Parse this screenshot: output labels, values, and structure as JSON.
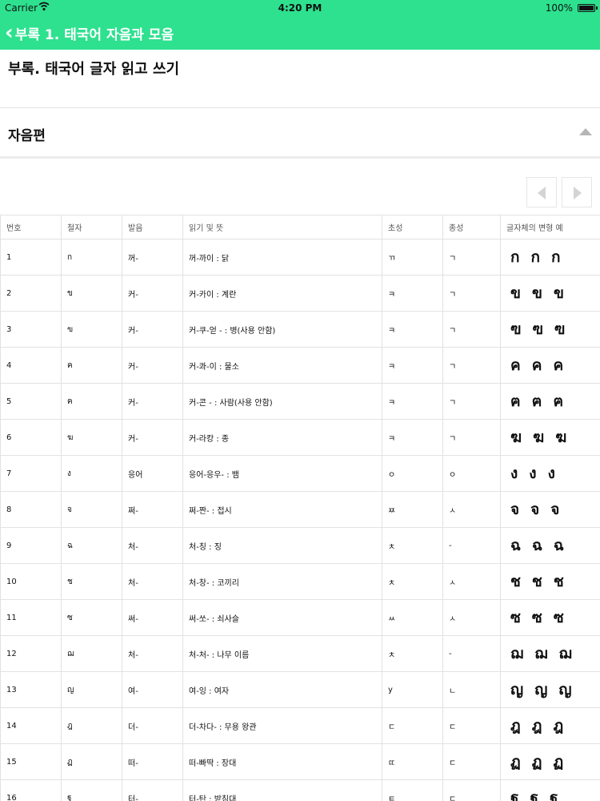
{
  "status_bar": {
    "carrier": "Carrier",
    "time": "4:20 PM",
    "battery": "100%"
  },
  "nav": {
    "back_label": "부록 1. 태국어 자음과 모음"
  },
  "document": {
    "title": "부록. 태국어 글자 읽고 쓰기"
  },
  "section": {
    "title": "자음편"
  },
  "table": {
    "headers": [
      "번호",
      "철자",
      "발음",
      "읽기 및 뜻",
      "초성",
      "종성",
      "글자체의 변형 예"
    ],
    "rows": [
      {
        "no": "1",
        "letter": "ก",
        "sound": "꺼-",
        "reading": "꺼-까이 : 닭",
        "initial": "ㄲ",
        "final": "ㄱ",
        "variants": [
          "ก",
          "ก",
          "ก"
        ]
      },
      {
        "no": "2",
        "letter": "ข",
        "sound": "커-",
        "reading": "커-카이 : 계란",
        "initial": "ㅋ",
        "final": "ㄱ",
        "variants": [
          "ข",
          "ข",
          "ข"
        ]
      },
      {
        "no": "3",
        "letter": "ฃ",
        "sound": "커-",
        "reading": "커-쿠-얻 - : 병(사용 안함)",
        "initial": "ㅋ",
        "final": "ㄱ",
        "variants": [
          "ฃ",
          "ฃ",
          "ฃ"
        ]
      },
      {
        "no": "4",
        "letter": "ค",
        "sound": "커-",
        "reading": "커-콰-이 : 물소",
        "initial": "ㅋ",
        "final": "ㄱ",
        "variants": [
          "ค",
          "ค",
          "ค"
        ]
      },
      {
        "no": "5",
        "letter": "ฅ",
        "sound": "커-",
        "reading": "커-콘 - : 사람(사용 안함)",
        "initial": "ㅋ",
        "final": "ㄱ",
        "variants": [
          "ฅ",
          "ฅ",
          "ฅ"
        ]
      },
      {
        "no": "6",
        "letter": "ฆ",
        "sound": "커-",
        "reading": "커-라캉 : 종",
        "initial": "ㅋ",
        "final": "ㄱ",
        "variants": [
          "ฆ",
          "ฆ",
          "ฆ"
        ]
      },
      {
        "no": "7",
        "letter": "ง",
        "sound": "응어",
        "reading": "응어-응우- : 뱀",
        "initial": "ㅇ",
        "final": "ㅇ",
        "variants": [
          "ง",
          "ง",
          "ง"
        ]
      },
      {
        "no": "8",
        "letter": "จ",
        "sound": "쩌-",
        "reading": "쩌-짠- : 접시",
        "initial": "ㅉ",
        "final": "ㅅ",
        "variants": [
          "จ",
          "จ",
          "จ"
        ]
      },
      {
        "no": "9",
        "letter": "ฉ",
        "sound": "처-",
        "reading": "처-칭 : 징",
        "initial": "ㅊ",
        "final": "-",
        "variants": [
          "ฉ",
          "ฉ",
          "ฉ"
        ]
      },
      {
        "no": "10",
        "letter": "ช",
        "sound": "처-",
        "reading": "처-창- : 코끼리",
        "initial": "ㅊ",
        "final": "ㅅ",
        "variants": [
          "ช",
          "ช",
          "ช"
        ]
      },
      {
        "no": "11",
        "letter": "ซ",
        "sound": "써-",
        "reading": "써-쏘- : 쇠사슬",
        "initial": "ㅆ",
        "final": "ㅅ",
        "variants": [
          "ซ",
          "ซ",
          "ซ"
        ]
      },
      {
        "no": "12",
        "letter": "ฌ",
        "sound": "처-",
        "reading": "처-처- : 나무 이름",
        "initial": "ㅊ",
        "final": "-",
        "variants": [
          "ฌ",
          "ฌ",
          "ฌ"
        ]
      },
      {
        "no": "13",
        "letter": "ญ",
        "sound": "여-",
        "reading": "여-잉 : 여자",
        "initial": "y",
        "final": "ㄴ",
        "variants": [
          "ญ",
          "ญ",
          "ญ"
        ]
      },
      {
        "no": "14",
        "letter": "ฎ",
        "sound": "더-",
        "reading": "더-차다- : 무용 왕관",
        "initial": "ㄷ",
        "final": "ㄷ",
        "variants": [
          "ฎ",
          "ฎ",
          "ฎ"
        ]
      },
      {
        "no": "15",
        "letter": "ฏ",
        "sound": "떠-",
        "reading": "떠-빠딱 : 장대",
        "initial": "ㄸ",
        "final": "ㄷ",
        "variants": [
          "ฏ",
          "ฏ",
          "ฏ"
        ]
      },
      {
        "no": "16",
        "letter": "ฐ",
        "sound": "터-",
        "reading": "터-탄 : 받침대",
        "initial": "ㅌ",
        "final": "ㄷ",
        "variants": [
          "ฐ",
          "ฐ",
          "ฐ"
        ]
      }
    ]
  },
  "colors": {
    "accent": "#2ee18f",
    "border": "#e2e2e2",
    "pager_arrow": "#d4d4d4"
  }
}
